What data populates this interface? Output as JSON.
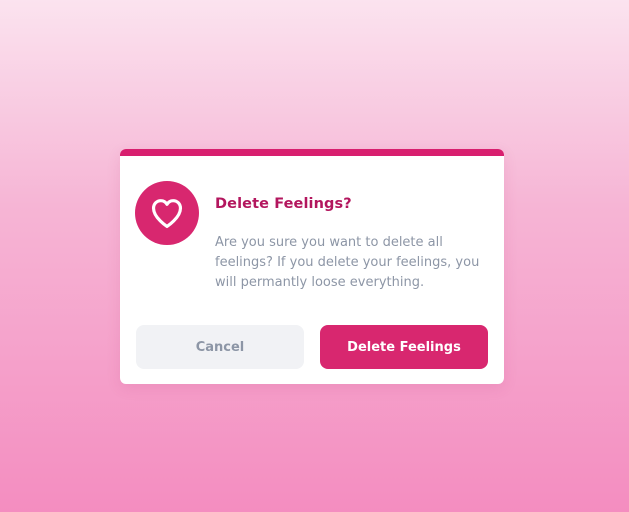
{
  "dialog": {
    "title": "Delete Feelings?",
    "message": "Are you sure you want to delete all feelings? If you delete your feelings, you will permantly loose everything.",
    "icon": "heart-icon",
    "cancel_label": "Cancel",
    "confirm_label": "Delete Feelings"
  },
  "colors": {
    "accent": "#d8276f",
    "title": "#b3165e",
    "muted_text": "#8d96a6",
    "cancel_bg": "#f1f2f5"
  }
}
